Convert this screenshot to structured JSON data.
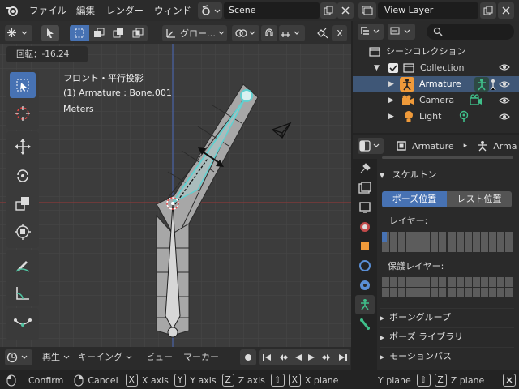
{
  "menus": {
    "file": "ファイル",
    "edit": "編集",
    "render": "レンダー",
    "window": "ウィンド"
  },
  "scene": {
    "name": "Scene"
  },
  "viewlayer": {
    "name": "View Layer"
  },
  "viewport": {
    "transform_orientation": "グロー…",
    "rotation_readout": "回転：-16.24",
    "view_name": "フロント・平行投影",
    "active_object": "(1) Armature : Bone.001",
    "units": "Meters",
    "close_label": "X"
  },
  "outliner": {
    "root": "シーンコレクション",
    "collection": "Collection",
    "items": [
      "Armature",
      "Camera",
      "Light"
    ]
  },
  "properties": {
    "breadcrumb_object": "Armature",
    "breadcrumb_data": "Arma",
    "section": "スケルトン",
    "pose_btn": "ポーズ位置",
    "rest_btn": "レスト位置",
    "layers_label": "レイヤー:",
    "protected_label": "保護レイヤー:",
    "groups": [
      "ボーングループ",
      "ポーズ ライブラリ",
      "モーションパス"
    ]
  },
  "timeline": {
    "playback": "再生",
    "keying": "キーイング",
    "view": "ビュー",
    "marker": "マーカー"
  },
  "status": {
    "confirm": "Confirm",
    "cancel": "Cancel",
    "x_key": "X",
    "x_axis": "X axis",
    "y_key": "Y",
    "y_axis": "Y axis",
    "z_key": "Z",
    "z_axis": "Z axis",
    "shift1": "⇧",
    "x2": "X",
    "x_plane": "X plane",
    "y_plane": "Y plane",
    "shift2": "⇧",
    "z2": "Z",
    "z_plane": "Z plane"
  },
  "colors": {
    "accent": "#4772b3",
    "select_cyan": "#5fd1d1",
    "armature_orange": "#ef9a3a",
    "data_green": "#3fbf8a"
  }
}
